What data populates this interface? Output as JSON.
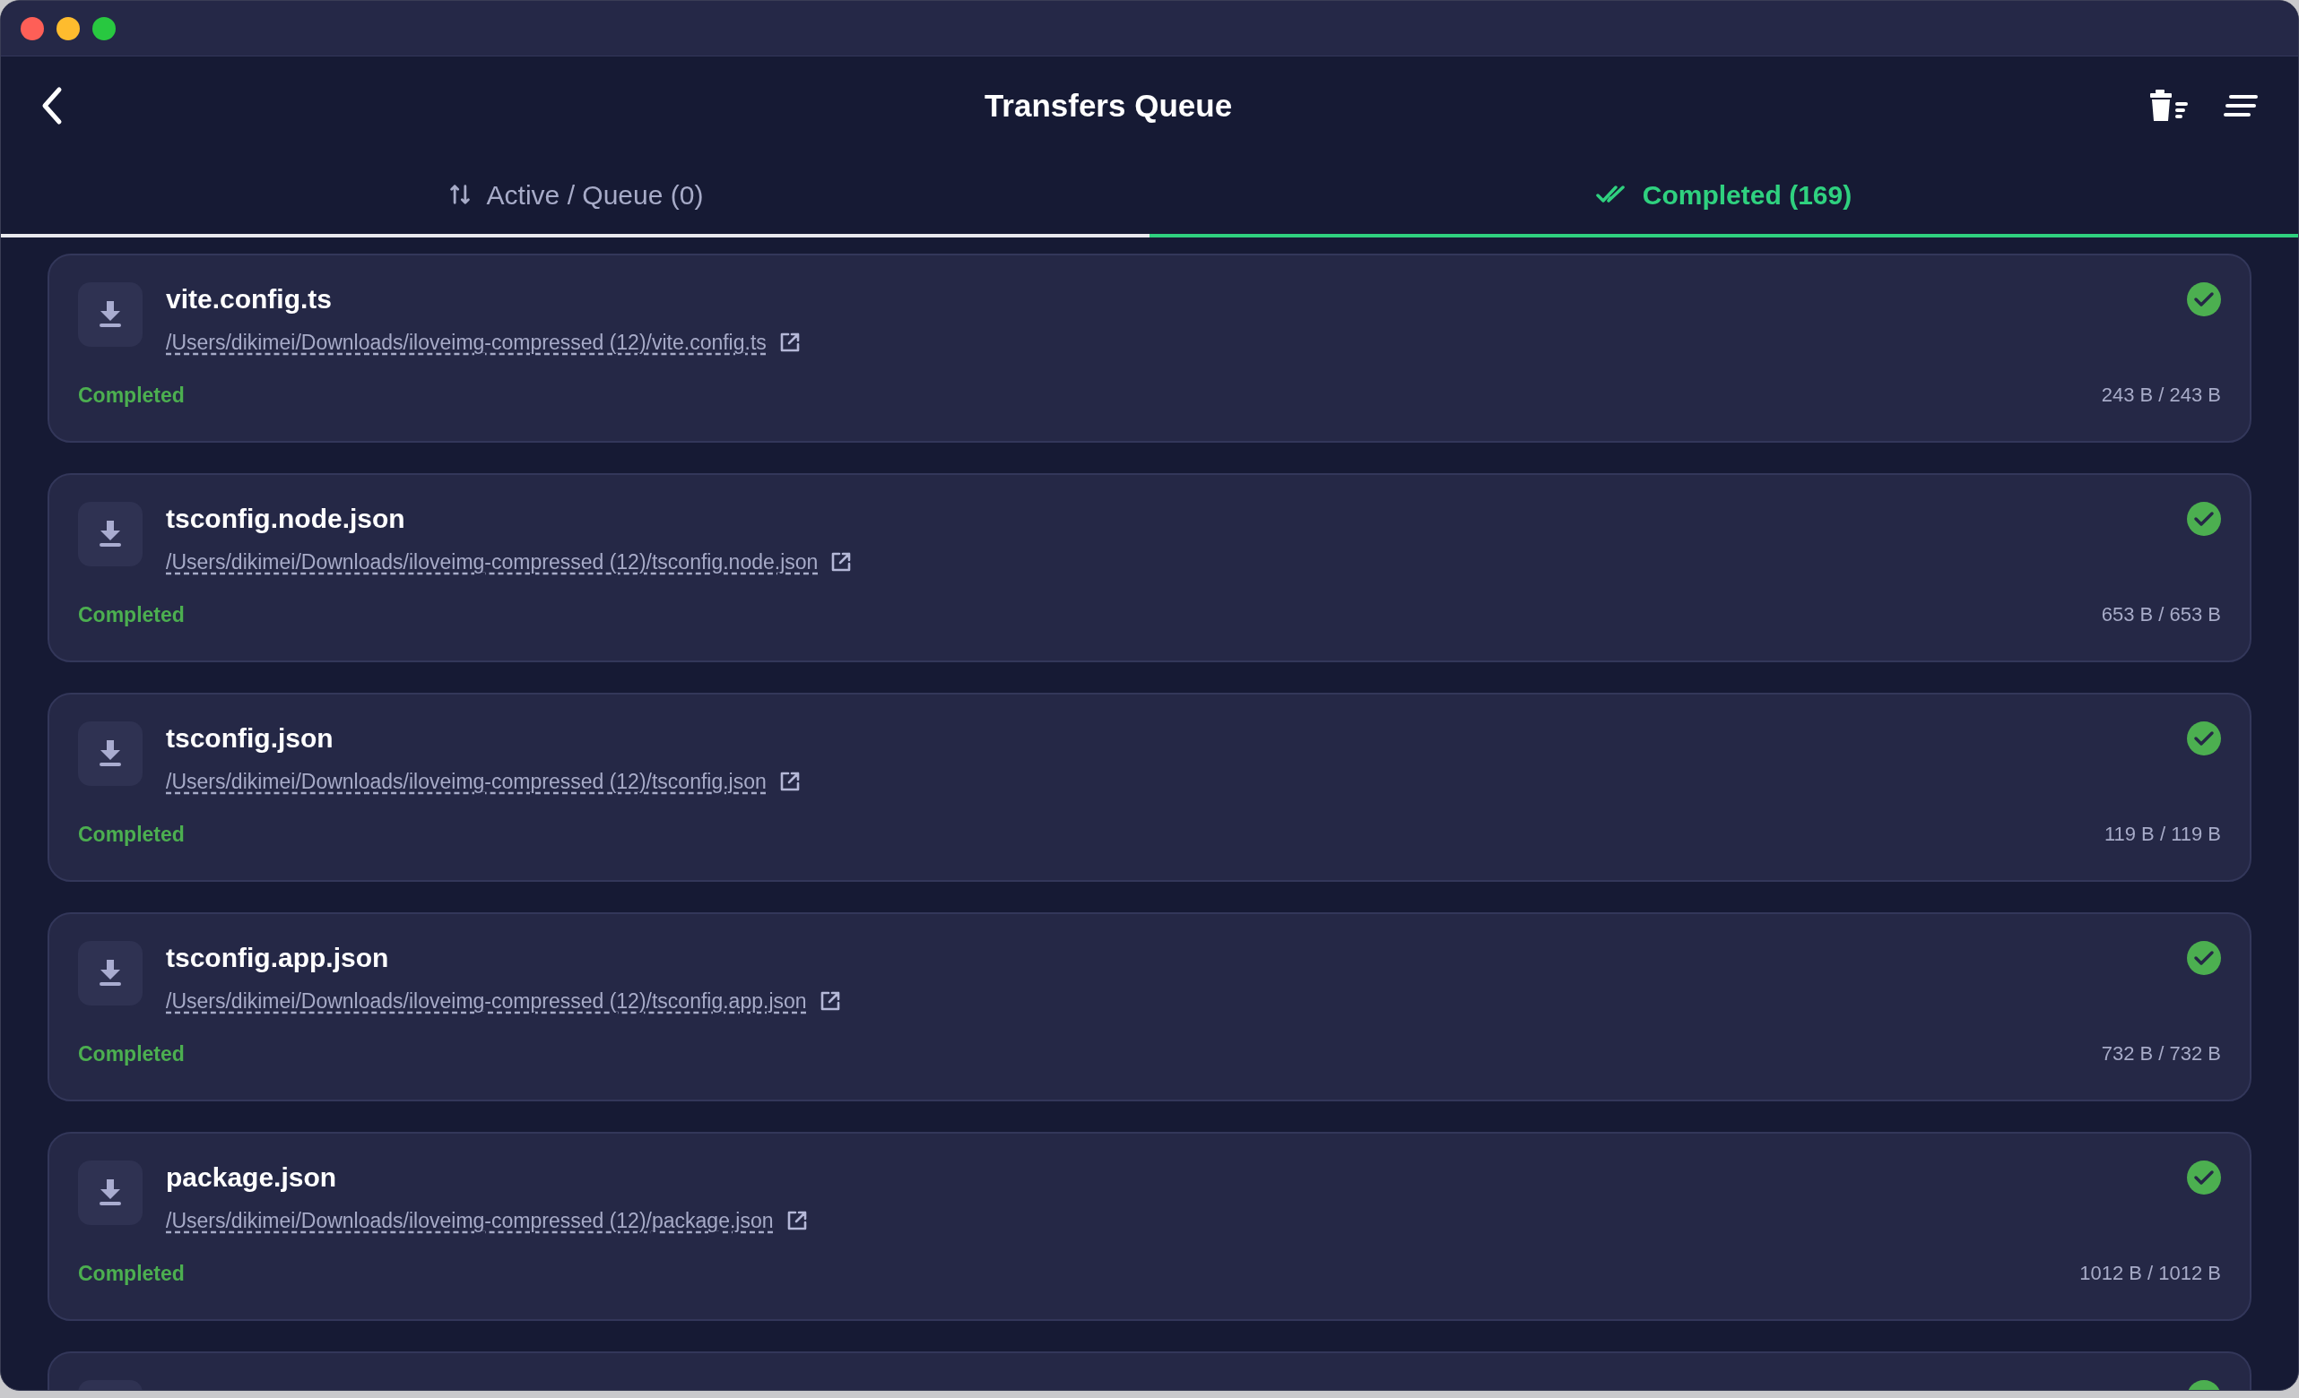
{
  "window": {
    "title": "Transfers Queue"
  },
  "tabs": [
    {
      "label": "Active / Queue (0)",
      "kind": "active",
      "selected": false
    },
    {
      "label": "Completed (169)",
      "kind": "completed",
      "selected": true
    }
  ],
  "transfers": [
    {
      "name": "vite.config.ts",
      "path": "/Users/dikimei/Downloads/iloveimg-compressed (12)/vite.config.ts",
      "status": "Completed",
      "done": true,
      "size": "243 B / 243 B"
    },
    {
      "name": "tsconfig.node.json",
      "path": "/Users/dikimei/Downloads/iloveimg-compressed (12)/tsconfig.node.json",
      "status": "Completed",
      "done": true,
      "size": "653 B / 653 B"
    },
    {
      "name": "tsconfig.json",
      "path": "/Users/dikimei/Downloads/iloveimg-compressed (12)/tsconfig.json",
      "status": "Completed",
      "done": true,
      "size": "119 B / 119 B"
    },
    {
      "name": "tsconfig.app.json",
      "path": "/Users/dikimei/Downloads/iloveimg-compressed (12)/tsconfig.app.json",
      "status": "Completed",
      "done": true,
      "size": "732 B / 732 B"
    },
    {
      "name": "package.json",
      "path": "/Users/dikimei/Downloads/iloveimg-compressed (12)/package.json",
      "status": "Completed",
      "done": true,
      "size": "1012 B / 1012 B"
    },
    {
      "done": true
    }
  ]
}
